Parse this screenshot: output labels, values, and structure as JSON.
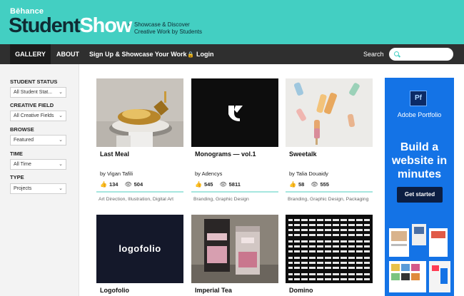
{
  "header": {
    "brand_small": "Bēhance",
    "brand_student": "Student",
    "brand_show": "Show",
    "tagline_line1": "Showcase & Discover",
    "tagline_line2": "Creative Work by Students",
    "bg_color": "#43cfc2"
  },
  "nav": {
    "gallery": "GALLERY",
    "about": "ABOUT",
    "signup": "Sign Up & Showcase Your Work",
    "login": "Login",
    "search_label": "Search",
    "search_value": ""
  },
  "filters": [
    {
      "label": "STUDENT STATUS",
      "value": "All Student Stat..."
    },
    {
      "label": "CREATIVE FIELD",
      "value": "All Creative Fields"
    },
    {
      "label": "BROWSE",
      "value": "Featured"
    },
    {
      "label": "TIME",
      "value": "All Time"
    },
    {
      "label": "TYPE",
      "value": "Projects"
    }
  ],
  "projects": [
    {
      "title": "Last Meal",
      "author": "by Vigan Tafili",
      "likes": "134",
      "views": "504",
      "fields": "Art Direction, Illustration, Digital Art"
    },
    {
      "title": "Monograms — vol.1",
      "author": "by Adencys",
      "likes": "545",
      "views": "5811",
      "fields": "Branding, Graphic Design"
    },
    {
      "title": "Sweetalk",
      "author": "by Talia Douaidy",
      "likes": "58",
      "views": "555",
      "fields": "Branding, Graphic Design, Packaging"
    },
    {
      "title": "Logofolio",
      "thumb_text": "logofolio"
    },
    {
      "title": "Imperial Tea"
    },
    {
      "title": "Domino"
    }
  ],
  "ad": {
    "logo": "Pf",
    "brand": "Adobe Portfolio",
    "headline": "Build a website in minutes",
    "cta": "Get started",
    "bg_color": "#1473e6"
  }
}
